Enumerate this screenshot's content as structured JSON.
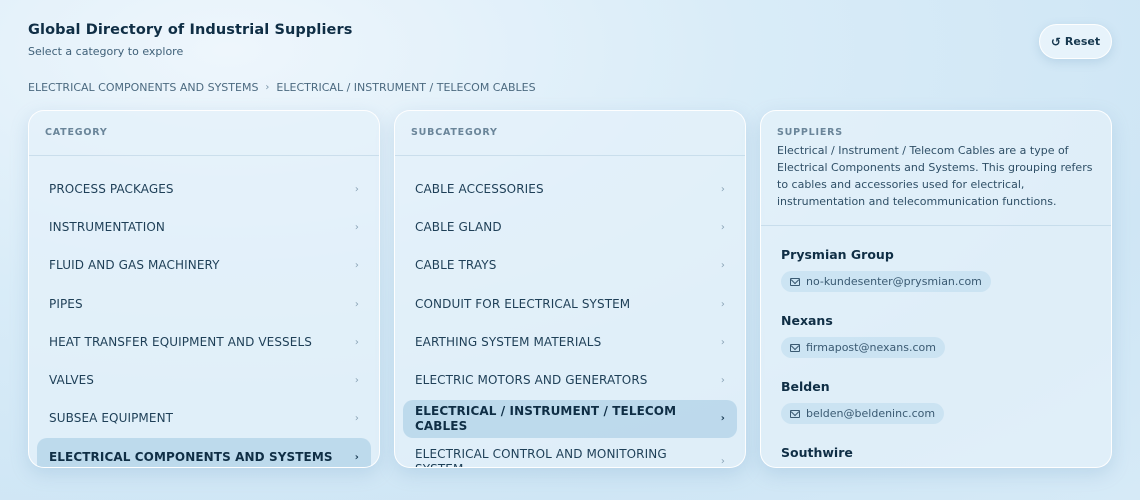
{
  "header": {
    "title": "Global Directory of Industrial Suppliers",
    "subtitle": "Select a category to explore"
  },
  "reset_button": {
    "icon": "↺",
    "label": "Reset"
  },
  "breadcrumb": [
    "ELECTRICAL COMPONENTS AND SYSTEMS",
    "ELECTRICAL / INSTRUMENT / TELECOM CABLES"
  ],
  "breadcrumb_sep": "›",
  "category_panel": {
    "heading": "CATEGORY",
    "items": [
      "PROCESS PACKAGES",
      "INSTRUMENTATION",
      "FLUID AND GAS MACHINERY",
      "PIPES",
      "HEAT TRANSFER EQUIPMENT AND VESSELS",
      "VALVES",
      "SUBSEA EQUIPMENT",
      "ELECTRICAL COMPONENTS AND SYSTEMS"
    ],
    "selected_index": 7
  },
  "subcategory_panel": {
    "heading": "SUBCATEGORY",
    "items": [
      "CABLE ACCESSORIES",
      "CABLE GLAND",
      "CABLE TRAYS",
      "CONDUIT FOR ELECTRICAL SYSTEM",
      "EARTHING SYSTEM MATERIALS",
      "ELECTRIC MOTORS AND GENERATORS",
      "ELECTRICAL / INSTRUMENT / TELECOM CABLES",
      "ELECTRICAL CONTROL AND MONITORING SYSTEM"
    ],
    "selected_index": 6
  },
  "suppliers_panel": {
    "heading": "SUPPLIERS",
    "description": "Electrical / Instrument / Telecom Cables are a type of Electrical Components and Systems. This grouping refers to cables and accessories used for electrical, instrumentation and telecommunication functions.",
    "suppliers": [
      {
        "name": "Prysmian Group",
        "email": "no-kundesenter@prysmian.com"
      },
      {
        "name": "Nexans",
        "email": "firmapost@nexans.com"
      },
      {
        "name": "Belden",
        "email": "belden@beldeninc.com"
      },
      {
        "name": "Southwire",
        "email": ""
      }
    ]
  },
  "chevron": "›"
}
